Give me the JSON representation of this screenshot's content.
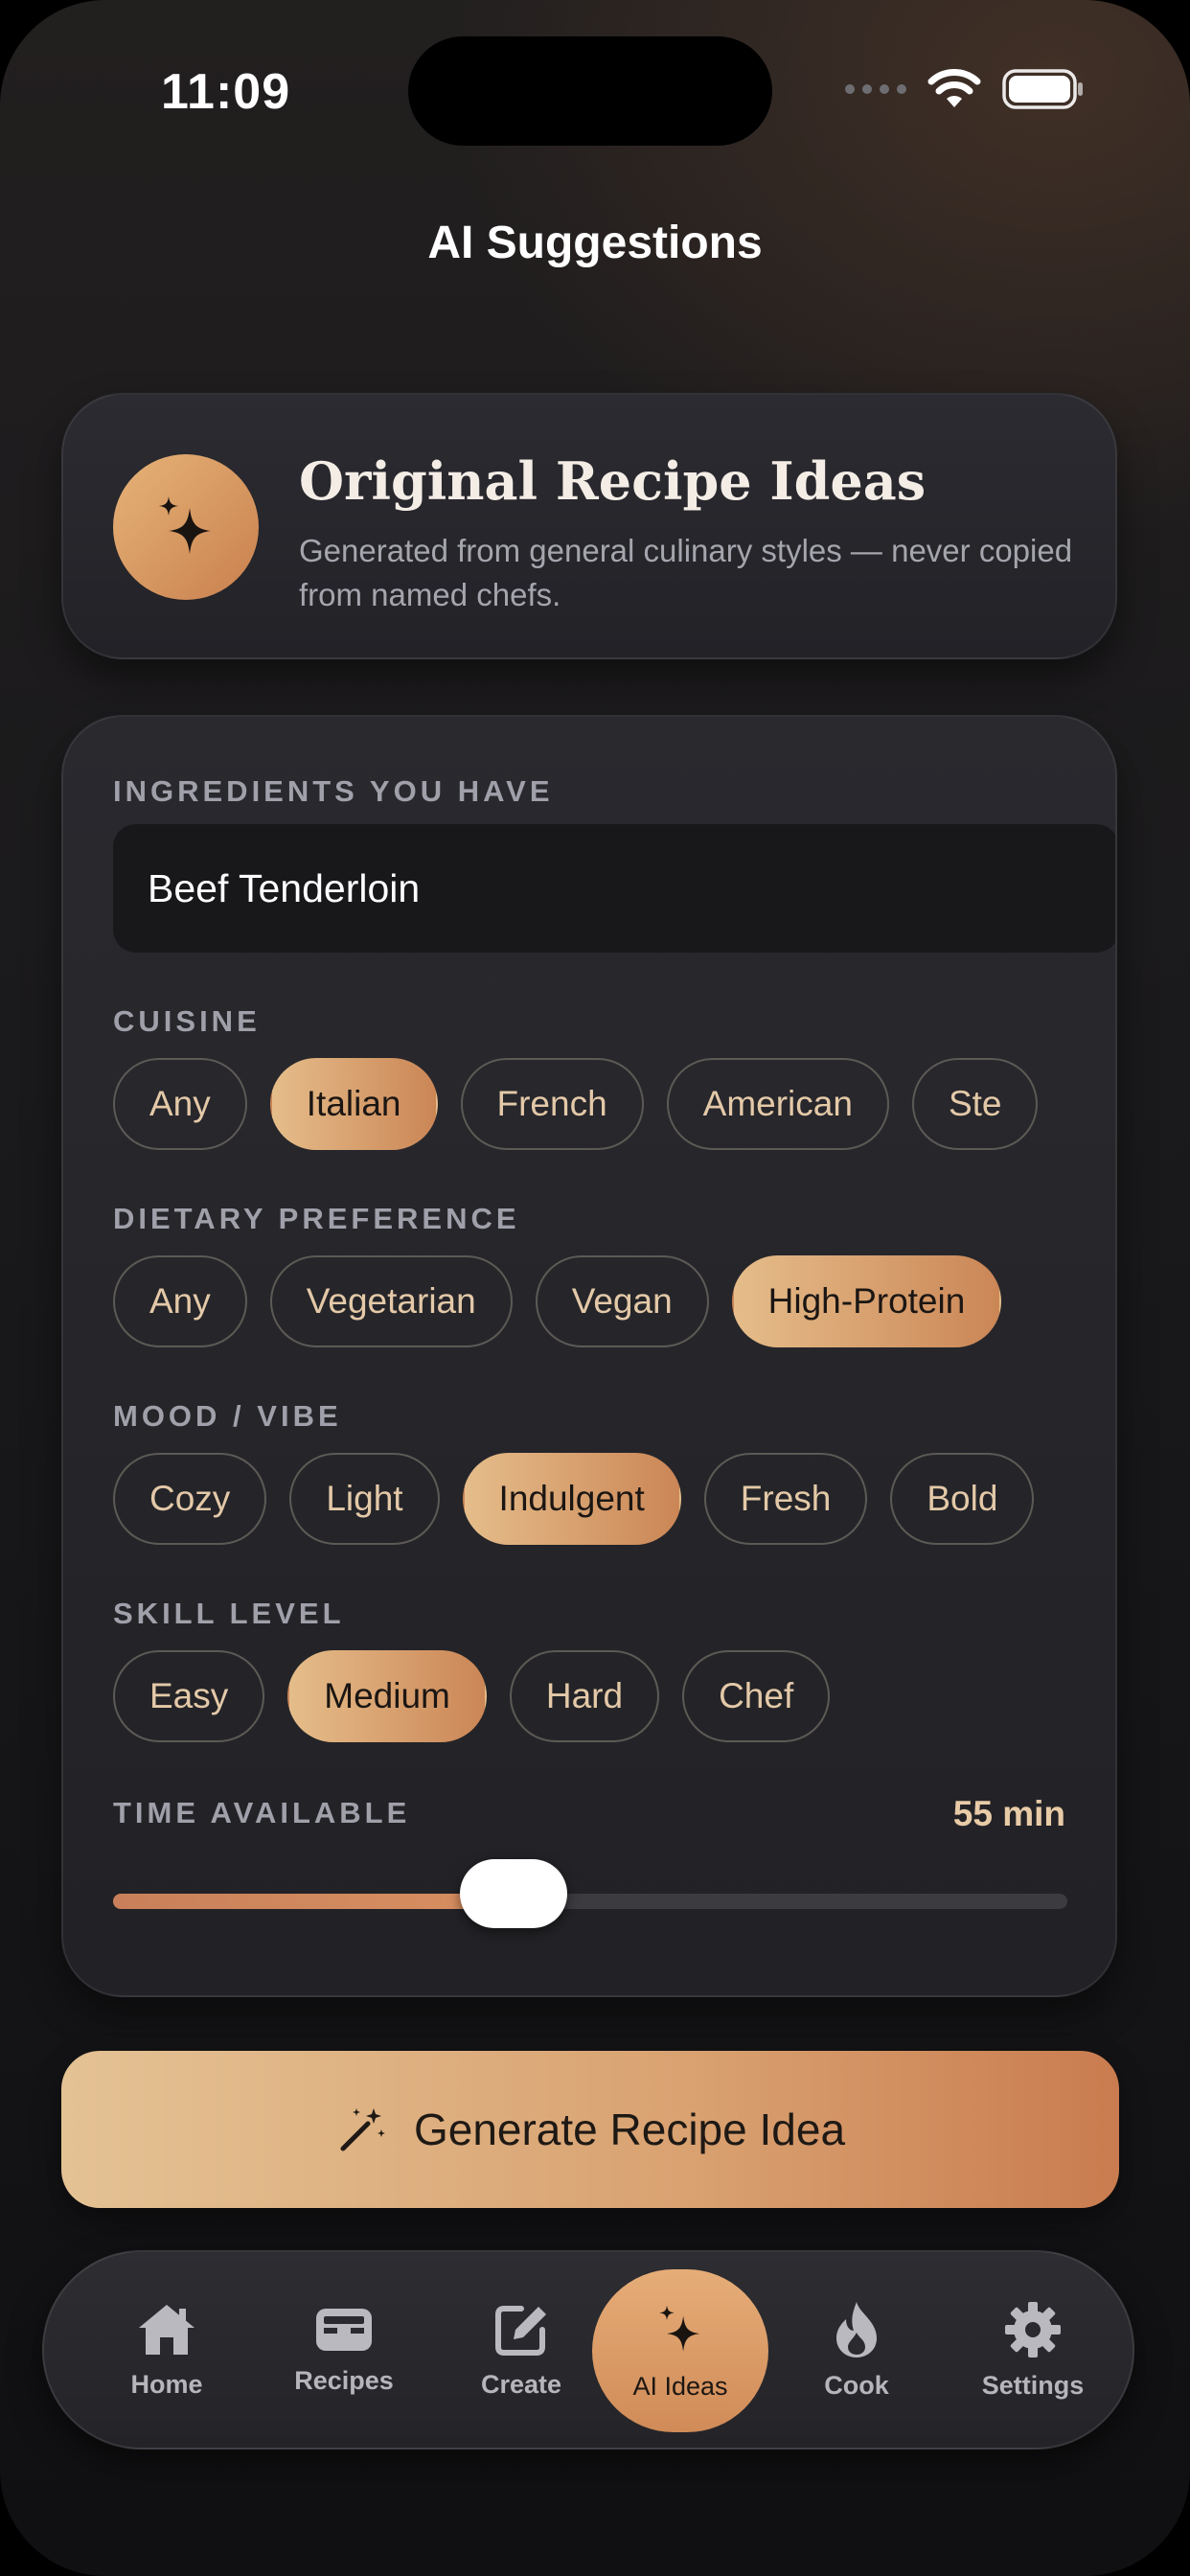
{
  "status_bar": {
    "time": "11:09"
  },
  "header": {
    "title": "AI Suggestions"
  },
  "hero": {
    "title": "Original Recipe Ideas",
    "subtitle": "Generated from general culinary styles — never copied from named chefs."
  },
  "form": {
    "ingredients_label": "INGREDIENTS YOU HAVE",
    "ingredients_value": "Beef Tenderloin",
    "cuisine_label": "CUISINE",
    "cuisine_options": [
      "Any",
      "Italian",
      "French",
      "American",
      "Ste"
    ],
    "cuisine_selected": "Italian",
    "dietary_label": "DIETARY PREFERENCE",
    "dietary_options": [
      "Any",
      "Vegetarian",
      "Vegan",
      "High-Protein"
    ],
    "dietary_selected": "High-Protein",
    "mood_label": "MOOD / VIBE",
    "mood_options": [
      "Cozy",
      "Light",
      "Indulgent",
      "Fresh",
      "Bold"
    ],
    "mood_selected": "Indulgent",
    "skill_label": "SKILL LEVEL",
    "skill_options": [
      "Easy",
      "Medium",
      "Hard",
      "Chef"
    ],
    "skill_selected": "Medium",
    "time_label": "TIME AVAILABLE",
    "time_value": "55 min",
    "time_fraction": 0.42
  },
  "generate_button": {
    "label": "Generate Recipe Idea"
  },
  "tab_bar": {
    "items": [
      {
        "label": "Home",
        "icon": "house-icon"
      },
      {
        "label": "Recipes",
        "icon": "tray-icon"
      },
      {
        "label": "Create",
        "icon": "edit-icon"
      },
      {
        "label": "AI Ideas",
        "icon": "sparkles-icon"
      },
      {
        "label": "Cook",
        "icon": "flame-icon"
      },
      {
        "label": "Settings",
        "icon": "gear-icon"
      }
    ],
    "active": "AI Ideas"
  },
  "colors": {
    "accent_start": "#e5bd8a",
    "accent_end": "#cb8656",
    "background": "#1b1a1c",
    "card": "#29292e"
  }
}
